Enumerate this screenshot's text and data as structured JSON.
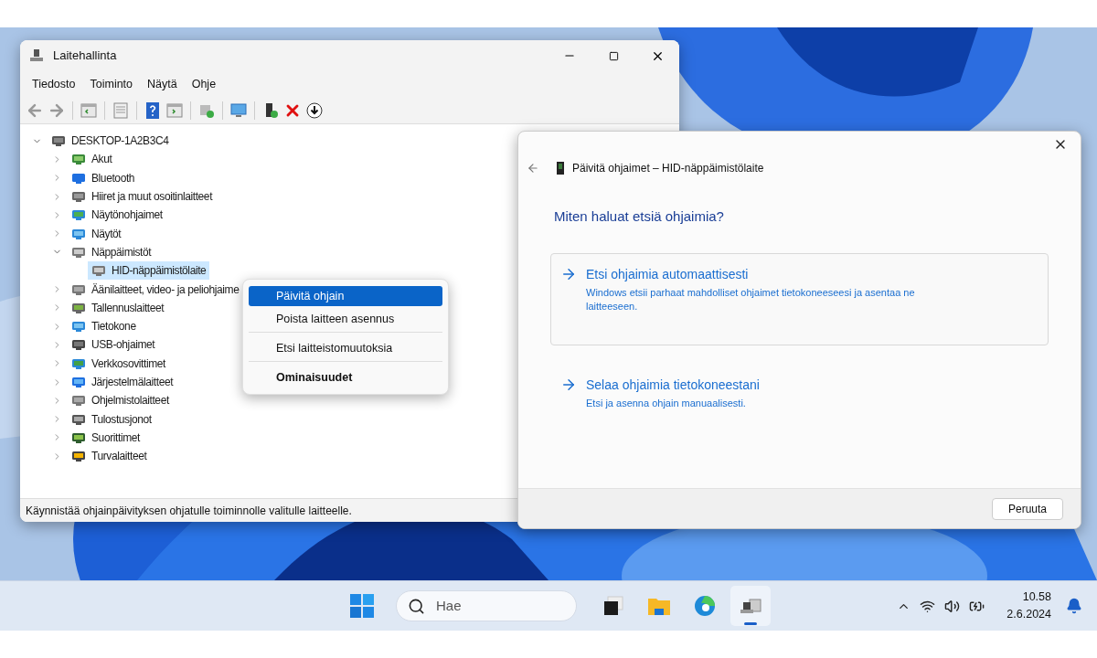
{
  "device_manager": {
    "title": "Laitehallinta",
    "menu": [
      "Tiedosto",
      "Toiminto",
      "Näytä",
      "Ohje"
    ],
    "tree": {
      "label": "DESKTOP-1A2B3C4",
      "expanded": true,
      "children": [
        {
          "label": "Akut",
          "expanded": false
        },
        {
          "label": "Bluetooth",
          "expanded": false
        },
        {
          "label": "Hiiret ja muut osoitinlaitteet",
          "expanded": false
        },
        {
          "label": "Näytönohjaimet",
          "expanded": false
        },
        {
          "label": "Näytöt",
          "expanded": false
        },
        {
          "label": "Näppäimistöt",
          "expanded": true,
          "children": [
            {
              "label": "HID-näppäimistölaite",
              "selected": true
            }
          ]
        },
        {
          "label": "Äänilaitteet, video- ja peliohjaime",
          "expanded": false
        },
        {
          "label": "Tallennuslaitteet",
          "expanded": false
        },
        {
          "label": "Tietokone",
          "expanded": false
        },
        {
          "label": "USB-ohjaimet",
          "expanded": false
        },
        {
          "label": "Verkkosovittimet",
          "expanded": false
        },
        {
          "label": "Järjestelmälaitteet",
          "expanded": false
        },
        {
          "label": "Ohjelmistolaitteet",
          "expanded": false
        },
        {
          "label": "Tulostusjonot",
          "expanded": false
        },
        {
          "label": "Suorittimet",
          "expanded": false
        },
        {
          "label": "Turvalaitteet",
          "expanded": false
        }
      ]
    },
    "status_bar": "Käynnistää ohjainpäivityksen ohjatulle toiminnolle valitulle laitteelle."
  },
  "context_menu": {
    "groups": [
      [
        {
          "label": "Päivitä ohjain",
          "selected": true,
          "default": false
        },
        {
          "label": "Poista laitteen asennus",
          "selected": false,
          "default": false
        }
      ],
      [
        {
          "label": "Etsi laitteistomuutoksia",
          "selected": false,
          "default": false
        }
      ],
      [
        {
          "label": "Ominaisuudet",
          "selected": false,
          "default": true
        }
      ]
    ]
  },
  "dialog": {
    "title": "Päivitä ohjaimet – HID-näppäimistölaite",
    "heading": "Miten haluat etsiä ohjaimia?",
    "options": [
      {
        "title": "Etsi ohjaimia automaattisesti",
        "description": "Windows etsii parhaat mahdolliset ohjaimet tietokoneeseesi ja asentaa ne laitteeseen.",
        "selected": true
      },
      {
        "title": "Selaa ohjaimia tietokoneestani",
        "description": "Etsi ja asenna ohjain manuaalisesti.",
        "selected": false
      }
    ],
    "buttons": [
      "Peruuta"
    ]
  },
  "taskbar": {
    "search": {
      "placeholder": "Hae"
    },
    "apps": [
      {
        "selected": false
      },
      {
        "selected": false
      },
      {
        "selected": false
      },
      {
        "selected": true
      }
    ],
    "time": "10.58",
    "date": "2.6.2024"
  }
}
